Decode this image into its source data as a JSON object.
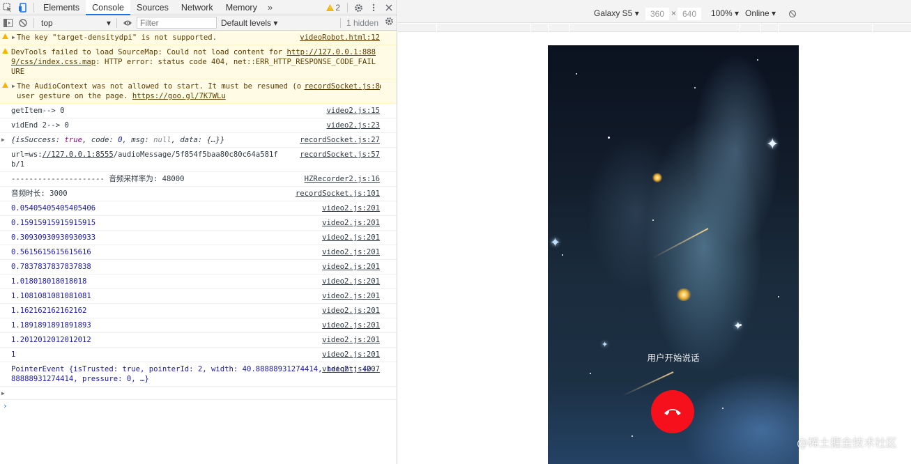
{
  "devtools": {
    "tabs": [
      "Elements",
      "Console",
      "Sources",
      "Network",
      "Memory"
    ],
    "active_tab": "Console",
    "more_tabs": "»",
    "warning_count": "2",
    "filterbar": {
      "context": "top",
      "filter_placeholder": "Filter",
      "levels": "Default levels",
      "hidden": "1 hidden"
    },
    "messages": [
      {
        "type": "warn",
        "expand": true,
        "text": "The key \"target-densitydpi\" is not supported.",
        "source": "videoRobot.html:12"
      },
      {
        "type": "warn",
        "expand": false,
        "text_before": "DevTools failed to load SourceMap: Could not load content for ",
        "link": "http://127.0.0.1:8889/css/index.css.map",
        "text_after": ": HTTP error: status code 404, net::ERR_HTTP_RESPONSE_CODE_FAILURE"
      },
      {
        "type": "warn",
        "expand": true,
        "text_before": "The AudioContext was not allowed to start. It must be resumed (or created) after a user gesture on the page. ",
        "link": "https://goo.gl/7K7WLu",
        "source": "recordSocket.js:8"
      },
      {
        "type": "log",
        "text": "getItem--> 0",
        "source": "video2.js:15"
      },
      {
        "type": "log",
        "text": "vidEnd 2--> 0",
        "source": "video2.js:23"
      },
      {
        "type": "log",
        "object": true,
        "text": "{isSuccess: true, code: 0, msg: null, data: {…}}",
        "source": "recordSocket.js:27"
      },
      {
        "type": "log",
        "text_before": "url=ws:",
        "link": "//127.0.0.1:8555",
        "text_after": "/audioMessage/5f854f5baa80c80c64a581fb/1",
        "source": "recordSocket.js:57"
      },
      {
        "type": "log",
        "text": "--------------------- 音频采样率为: 48000",
        "source": "HZRecorder2.js:16"
      },
      {
        "type": "log",
        "text": "音频时长: 3000",
        "source": "recordSocket.js:101"
      },
      {
        "type": "num",
        "text": "0.05405405405405406",
        "source": "video2.js:201"
      },
      {
        "type": "num",
        "text": "0.15915915915915915",
        "source": "video2.js:201"
      },
      {
        "type": "num",
        "text": "0.30930930930930933",
        "source": "video2.js:201"
      },
      {
        "type": "num",
        "text": "0.5615615615615616",
        "source": "video2.js:201"
      },
      {
        "type": "num",
        "text": "0.7837837837837838",
        "source": "video2.js:201"
      },
      {
        "type": "num",
        "text": "1.018018018018018",
        "source": "video2.js:201"
      },
      {
        "type": "num",
        "text": "1.1081081081081081",
        "source": "video2.js:201"
      },
      {
        "type": "num",
        "text": "1.162162162162162",
        "source": "video2.js:201"
      },
      {
        "type": "num",
        "text": "1.1891891891891893",
        "source": "video2.js:201"
      },
      {
        "type": "num",
        "text": "1.2012012012012012",
        "source": "video2.js:201"
      },
      {
        "type": "num",
        "text": "1",
        "source": "video2.js:201"
      },
      {
        "type": "pointer",
        "source": "video2.js:207",
        "text": "PointerEvent {isTrusted: true, pointerId: 2, width: 40.88888931274414, height: 40.88888931274414, pressure: 0, …}",
        "after": "1"
      }
    ],
    "prompt": "›"
  },
  "device_toolbar": {
    "device": "Galaxy S5",
    "width": "360",
    "times": "×",
    "height": "640",
    "zoom": "100%",
    "network": "Online"
  },
  "phone": {
    "status_text": "用户开始说话"
  },
  "watermark": "@稀土掘金技术社区",
  "colors": {
    "warn_bg": "#fffbe5",
    "hangup": "#f6101b",
    "accent": "#1a73e8"
  }
}
